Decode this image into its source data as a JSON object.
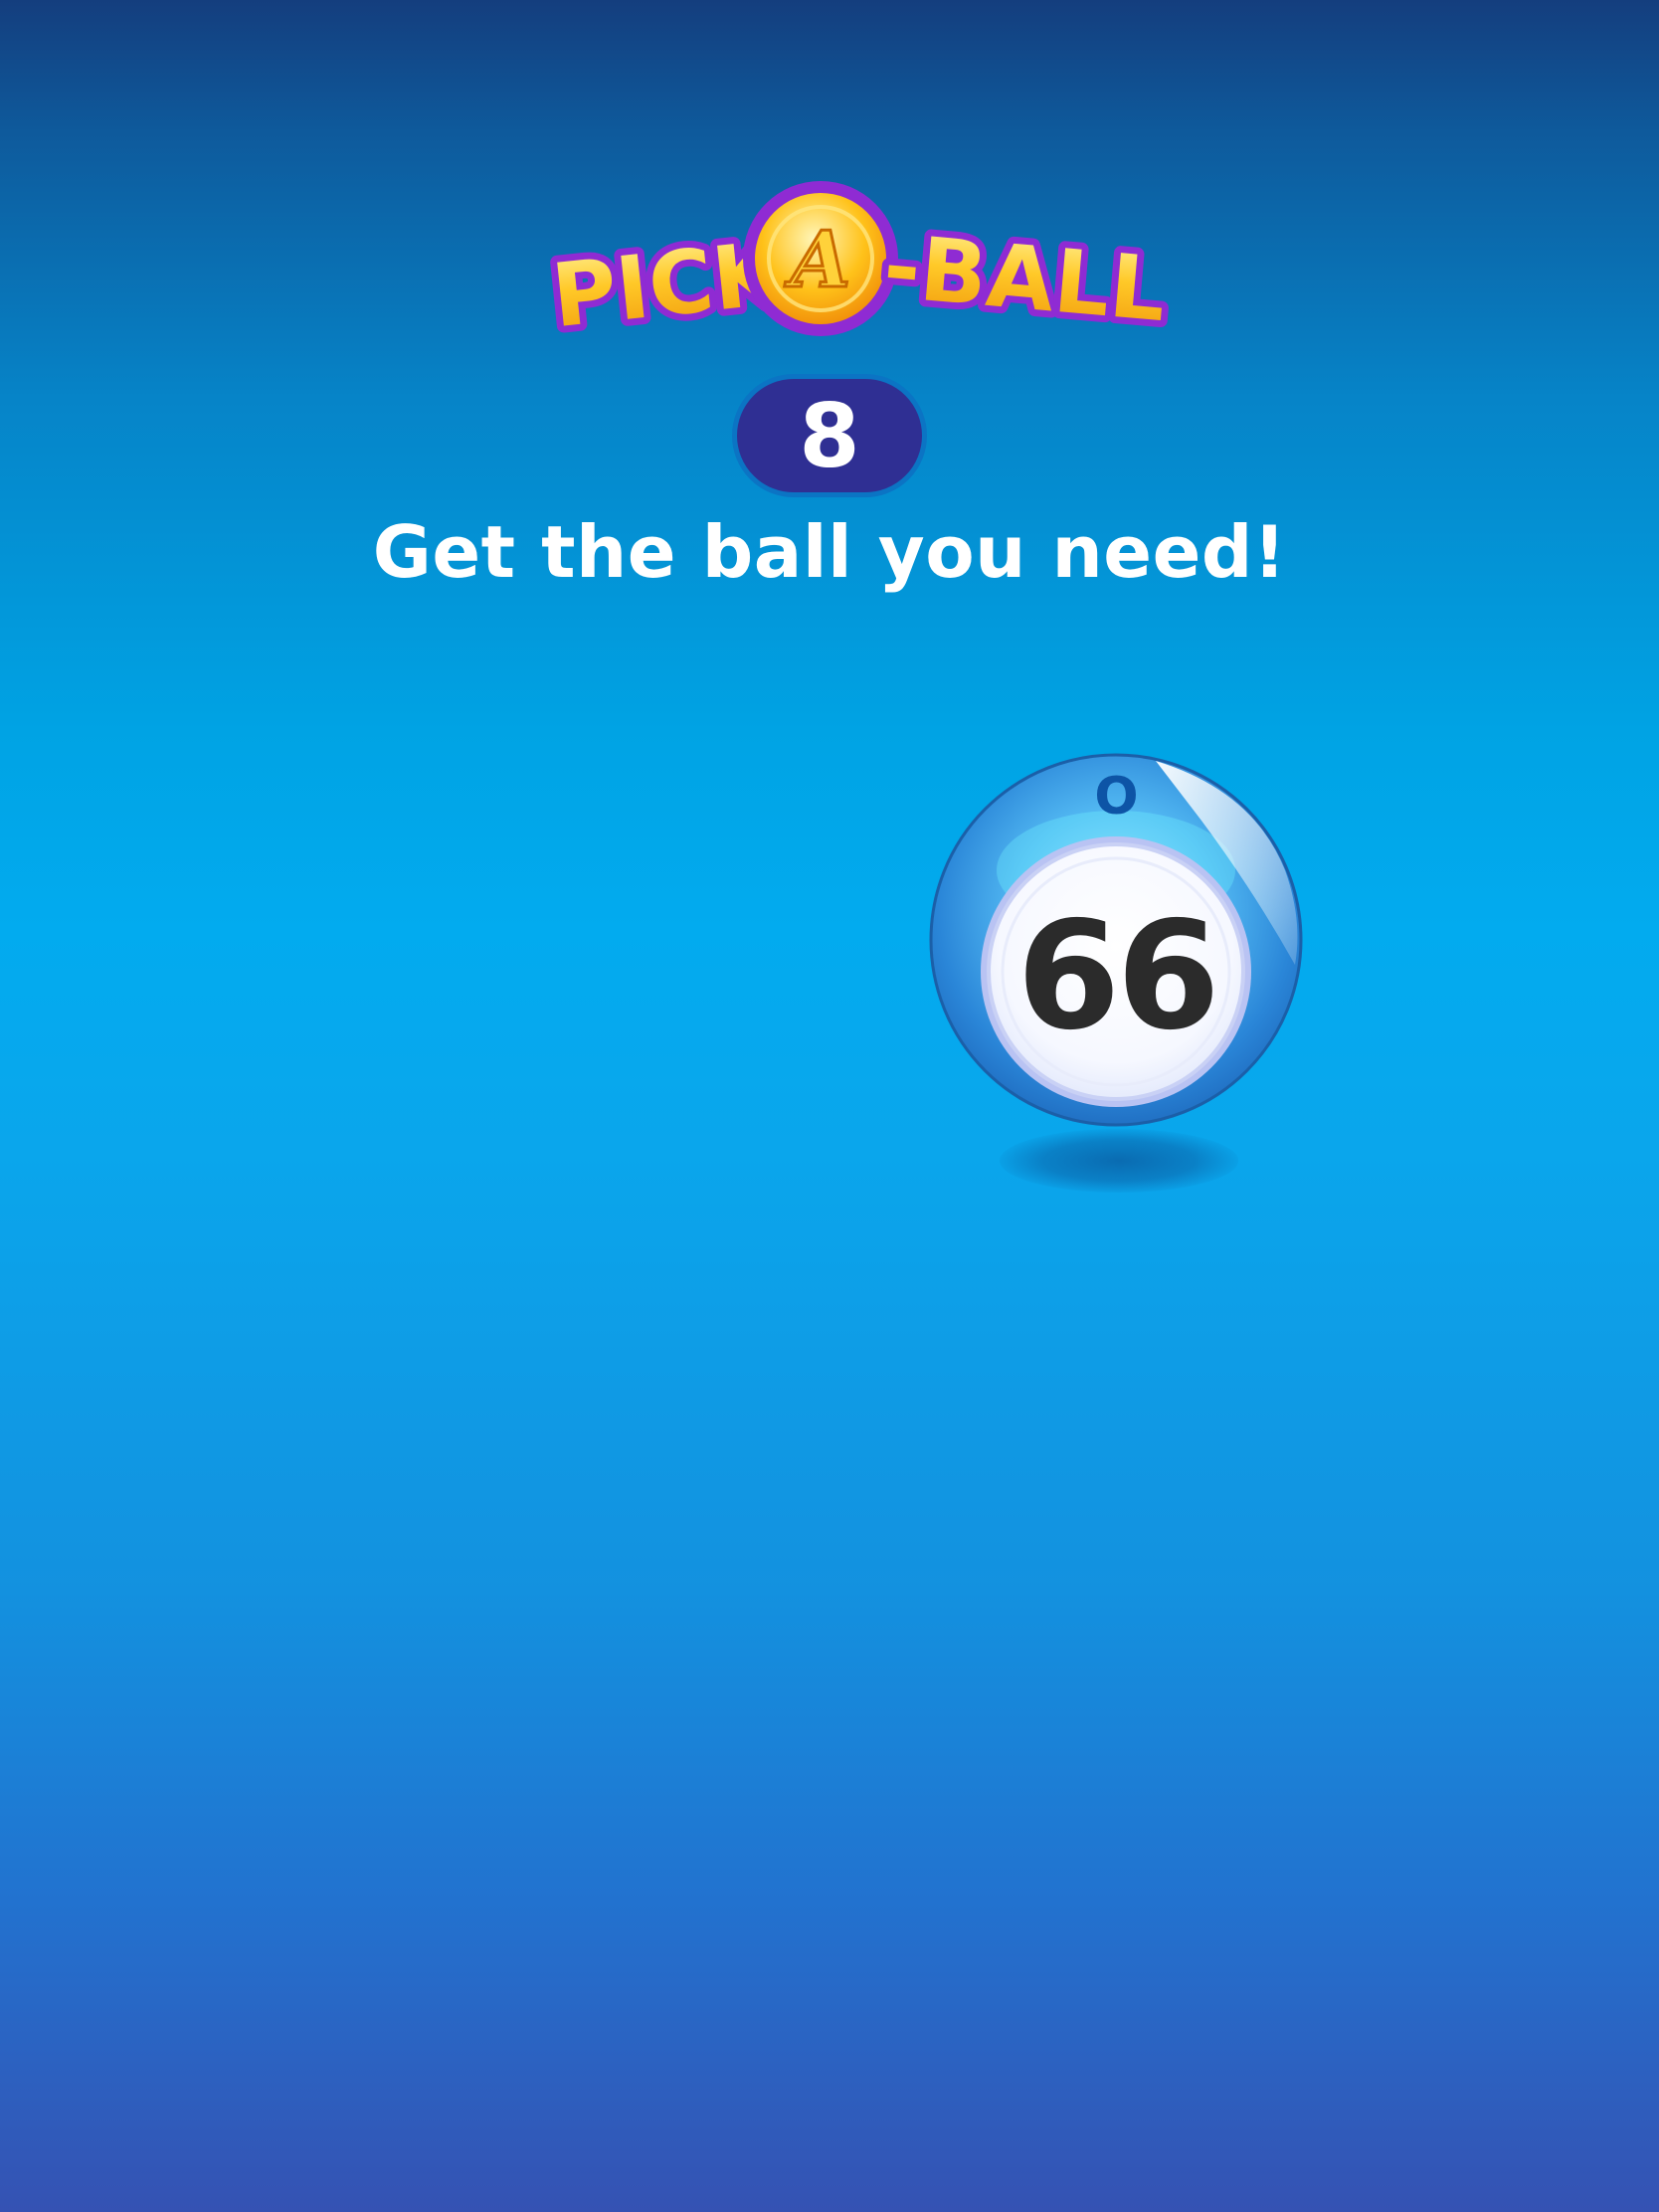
{
  "logo": {
    "left_text": "PICK-",
    "center_letter": "A",
    "right_text": "-BALL"
  },
  "counter": {
    "value": "8"
  },
  "instruction": "Get the ball you need!",
  "ball": {
    "letter": "O",
    "number": "66"
  },
  "colors": {
    "logo_fill": "#ffc21a",
    "logo_outline": "#8f2bd3",
    "pill_bg": "#2f2f93",
    "ball_number": "#2b2b2b",
    "ball_letter": "#0d54a6"
  }
}
